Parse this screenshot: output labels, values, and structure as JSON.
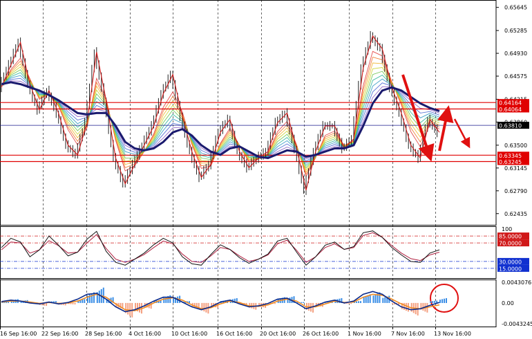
{
  "chart_data": {
    "type": "line",
    "main_panel": {
      "price_axis": {
        "ticks": [
          "0.65645",
          "0.65285",
          "0.64930",
          "0.64575",
          "0.64215",
          "0.63860",
          "0.63500",
          "0.63145",
          "0.62790",
          "0.62435"
        ],
        "tick_values": [
          0.65645,
          0.65285,
          0.6493,
          0.64575,
          0.64215,
          0.6386,
          0.635,
          0.63145,
          0.6279,
          0.62435
        ]
      },
      "horizontal_levels": [
        {
          "label": "0.64164",
          "value": 0.64164,
          "color": "#e00000"
        },
        {
          "label": "0.64064",
          "value": 0.64064,
          "color": "#e00000"
        },
        {
          "label": "0.63345",
          "value": 0.63345,
          "color": "#e00000"
        },
        {
          "label": "0.63245",
          "value": 0.63245,
          "color": "#e00000"
        }
      ],
      "current_price": {
        "label": "0.63810",
        "value": 0.6381,
        "color": "#1a1a8c"
      },
      "price_path": [
        0.644,
        0.6475,
        0.651,
        0.6445,
        0.6405,
        0.6435,
        0.64,
        0.635,
        0.6335,
        0.6385,
        0.6495,
        0.642,
        0.633,
        0.629,
        0.632,
        0.635,
        0.638,
        0.643,
        0.646,
        0.6395,
        0.634,
        0.63,
        0.632,
        0.637,
        0.639,
        0.634,
        0.6315,
        0.633,
        0.634,
        0.6385,
        0.64,
        0.6345,
        0.628,
        0.634,
        0.638,
        0.638,
        0.6345,
        0.636,
        0.647,
        0.652,
        0.65,
        0.644,
        0.64,
        0.635,
        0.633,
        0.639,
        0.637
      ],
      "ma_slow": [
        0.6445,
        0.6448,
        0.6445,
        0.644,
        0.6435,
        0.6428,
        0.642,
        0.641,
        0.64,
        0.6398,
        0.64,
        0.64,
        0.638,
        0.6355,
        0.6345,
        0.6342,
        0.6345,
        0.6355,
        0.637,
        0.6375,
        0.6365,
        0.635,
        0.634,
        0.6335,
        0.6345,
        0.6348,
        0.634,
        0.6332,
        0.633,
        0.6336,
        0.6342,
        0.634,
        0.6332,
        0.6335,
        0.634,
        0.6345,
        0.6345,
        0.635,
        0.638,
        0.6415,
        0.6435,
        0.644,
        0.6435,
        0.6425,
        0.6415,
        0.6408,
        0.6403
      ],
      "ma_fast": [
        0.644,
        0.647,
        0.649,
        0.6455,
        0.642,
        0.643,
        0.641,
        0.637,
        0.6345,
        0.6375,
        0.646,
        0.6425,
        0.6355,
        0.6305,
        0.6315,
        0.634,
        0.637,
        0.6415,
        0.644,
        0.6405,
        0.635,
        0.631,
        0.6315,
        0.6355,
        0.638,
        0.635,
        0.6322,
        0.6328,
        0.6338,
        0.6375,
        0.6392,
        0.6352,
        0.6298,
        0.633,
        0.6368,
        0.6375,
        0.635,
        0.6358,
        0.645,
        0.6505,
        0.6495,
        0.645,
        0.641,
        0.6365,
        0.634,
        0.638,
        0.6372
      ]
    },
    "stochastic_panel": {
      "levels": [
        {
          "label": "85.0000",
          "value": 85
        },
        {
          "label": "70.0000",
          "value": 70
        },
        {
          "label": "30.0000",
          "value": 30
        },
        {
          "label": "15.0000",
          "value": 15
        }
      ],
      "axis_top_label": "100",
      "line_k": [
        60,
        80,
        72,
        40,
        55,
        85,
        65,
        42,
        50,
        78,
        95,
        52,
        28,
        22,
        35,
        48,
        66,
        80,
        70,
        40,
        25,
        22,
        45,
        66,
        56,
        38,
        26,
        35,
        46,
        74,
        80,
        50,
        22,
        40,
        65,
        72,
        56,
        62,
        92,
        96,
        82,
        60,
        44,
        30,
        28,
        48,
        55
      ],
      "line_d": [
        55,
        72,
        70,
        48,
        55,
        75,
        64,
        48,
        50,
        70,
        88,
        58,
        35,
        28,
        35,
        45,
        60,
        74,
        68,
        46,
        30,
        28,
        42,
        60,
        56,
        42,
        30,
        35,
        44,
        68,
        76,
        54,
        28,
        40,
        60,
        68,
        56,
        60,
        86,
        92,
        82,
        64,
        48,
        36,
        32,
        44,
        50
      ]
    },
    "macd_panel": {
      "axis_labels": [
        "0.0043076",
        "0.00",
        "-0.0043245"
      ],
      "axis_values": [
        0.0043076,
        0,
        -0.0043245
      ],
      "histogram": [
        0.0002,
        0.0008,
        0.0006,
        0.0001,
        -0.0006,
        0.0004,
        -0.0005,
        -0.0003,
        0.0008,
        0.0022,
        0.0032,
        0.0012,
        -0.0012,
        -0.003,
        -0.0022,
        -0.0012,
        0.0006,
        0.0016,
        0.0015,
        0.0004,
        -0.0012,
        -0.0022,
        -0.001,
        0.0006,
        0.001,
        -0.0004,
        -0.0014,
        -0.001,
        -0.0002,
        0.0012,
        0.0014,
        0.0002,
        -0.002,
        -0.0008,
        0.0004,
        0.001,
        -0.0002,
        0.0004,
        0.0018,
        0.0022,
        0.0015,
        -0.0004,
        -0.0018,
        -0.0026,
        -0.002,
        0.0005,
        0.001
      ],
      "signal_line": [
        0.0002,
        0.0004,
        0.0004,
        0.0002,
        -0.0001,
        0.0001,
        -0.0001,
        0.0,
        0.0004,
        0.0012,
        0.0018,
        0.0012,
        -0.0002,
        -0.0014,
        -0.0016,
        -0.001,
        0.0,
        0.0008,
        0.0011,
        0.0006,
        -0.0004,
        -0.0012,
        -0.001,
        -0.0002,
        0.0004,
        0.0001,
        -0.0006,
        -0.0007,
        -0.0004,
        0.0004,
        0.0008,
        0.0004,
        -0.0008,
        -0.0008,
        -0.0002,
        0.0004,
        0.0001,
        0.0002,
        0.0012,
        0.0018,
        0.0016,
        0.0008,
        -0.0002,
        -0.001,
        -0.0012,
        -0.0008,
        -0.0004
      ],
      "fast_line": [
        0.0003,
        0.0006,
        0.0004,
        0.0,
        -0.0002,
        0.0002,
        -0.0002,
        0.0001,
        0.0008,
        0.0018,
        0.002,
        0.0008,
        -0.0008,
        -0.0018,
        -0.0014,
        -0.0006,
        0.0004,
        0.0012,
        0.0012,
        0.0002,
        -0.0008,
        -0.0014,
        -0.0008,
        0.0002,
        0.0006,
        -0.0002,
        -0.0008,
        -0.0006,
        -0.0001,
        0.0008,
        0.001,
        0.0,
        -0.0012,
        -0.0006,
        0.0002,
        0.0006,
        0.0,
        0.0004,
        0.0018,
        0.0024,
        0.0018,
        0.0004,
        -0.0008,
        -0.0014,
        -0.0012,
        -0.0005,
        0.0001
      ]
    },
    "time_axis": [
      "16 Sep 16:00",
      "22 Sep 16:00",
      "28 Sep 16:00",
      "4 Oct 16:00",
      "10 Oct 16:00",
      "16 Oct 16:00",
      "20 Oct 16:00",
      "26 Oct 16:00",
      "1 Nov 16:00",
      "7 Nov 16:00",
      "13 Nov 16:00"
    ],
    "grid": true,
    "colors": {
      "level_red": "#e00000",
      "price_blue": "#1a1a8c",
      "ma_slow": "#1a1a6e",
      "hist_pos": "#3a8ee6",
      "hist_neg": "#f4a080",
      "macd_fast": "#0a2a8c",
      "macd_signal": "#f08a20",
      "stoch_k": "#111111",
      "stoch_d": "#b02040",
      "annot_red": "#e01010"
    }
  }
}
